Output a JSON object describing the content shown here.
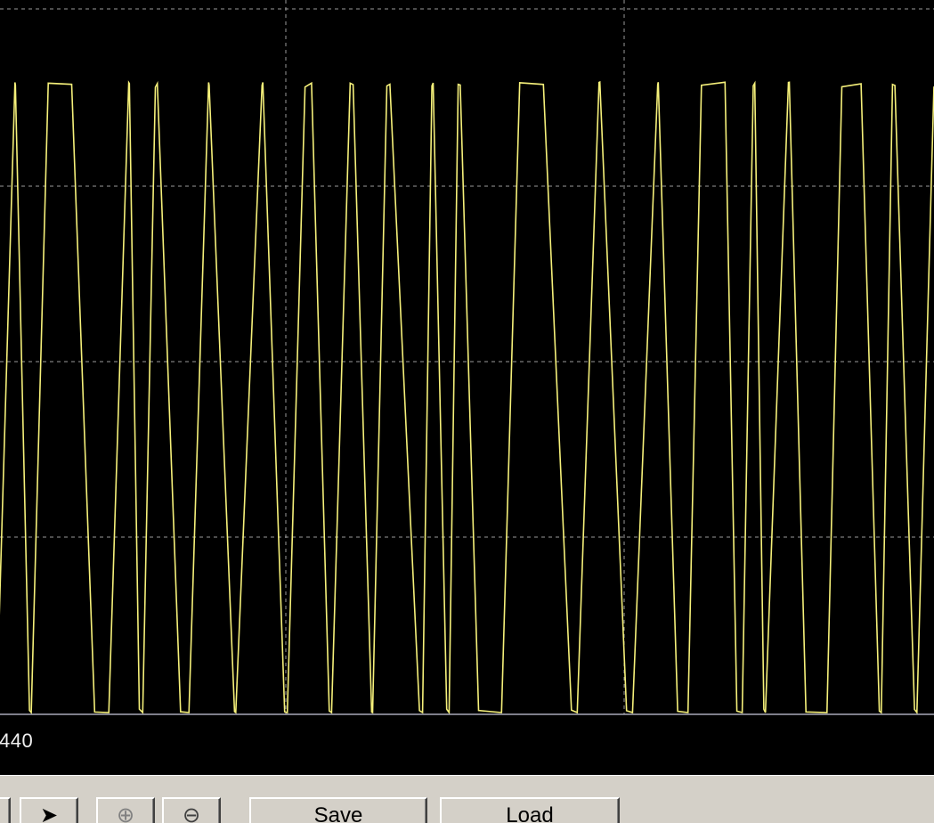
{
  "scope": {
    "background": "#000000",
    "trace_color": "#f5f07a",
    "grid_color": "#9a9a9a",
    "grid": true,
    "readout": "440"
  },
  "toolbar": {
    "nav_button_icon": "arrow-right-icon",
    "zoom_in_icon": "zoom-in-icon",
    "zoom_out_icon": "zoom-out-icon",
    "save_label": "Save",
    "load_label": "Load"
  }
}
